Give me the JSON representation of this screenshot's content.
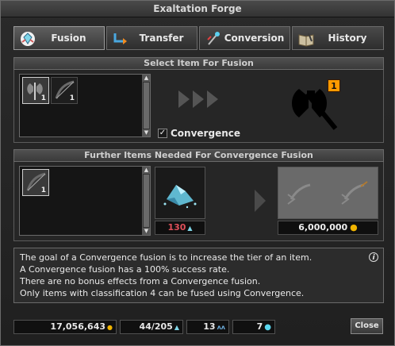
{
  "window": {
    "title": "Exaltation Forge"
  },
  "tabs": [
    {
      "label": "Fusion",
      "icon": "fusion-crystal-icon",
      "active": true
    },
    {
      "label": "Transfer",
      "icon": "transfer-arrow-icon",
      "active": false
    },
    {
      "label": "Conversion",
      "icon": "conversion-wand-icon",
      "active": false
    },
    {
      "label": "History",
      "icon": "history-book-icon",
      "active": false
    }
  ],
  "select_section": {
    "title": "Select Item For Fusion",
    "items": [
      {
        "icon": "battle-axe-icon",
        "quantity": "1",
        "selected": true
      },
      {
        "icon": "bow-icon",
        "quantity": "1",
        "selected": false
      }
    ],
    "result_badge": "1",
    "result_icon": "battle-axe-silhouette-icon",
    "convergence_checkbox": {
      "label": "Convergence",
      "checked": true,
      "mark": "✓"
    }
  },
  "further_section": {
    "title": "Further Items Needed For Convergence Fusion",
    "items": [
      {
        "icon": "bow-icon",
        "quantity": "1"
      }
    ],
    "material": {
      "icon": "crystal-shards-icon",
      "amount": "130"
    },
    "cost": {
      "value": "6,000,000",
      "icon": "gold-coin-icon"
    }
  },
  "description": {
    "lines": [
      "The goal of a Convergence fusion is to increase the tier of an item.",
      "A Convergence fusion has a 100% success rate.",
      "There are no bonus effects from a Convergence fusion.",
      "Only items with classification 4 can be fused using Convergence."
    ],
    "info_icon": "i"
  },
  "footer": {
    "gold": "17,056,643",
    "shards": "44/205",
    "tokens": "13",
    "gems": "7",
    "close_label": "Close"
  },
  "colors": {
    "gold": "#f0b400",
    "red_amount": "#e0505a",
    "crystal": "#7fd6e8",
    "badge": "#ff9a00"
  }
}
